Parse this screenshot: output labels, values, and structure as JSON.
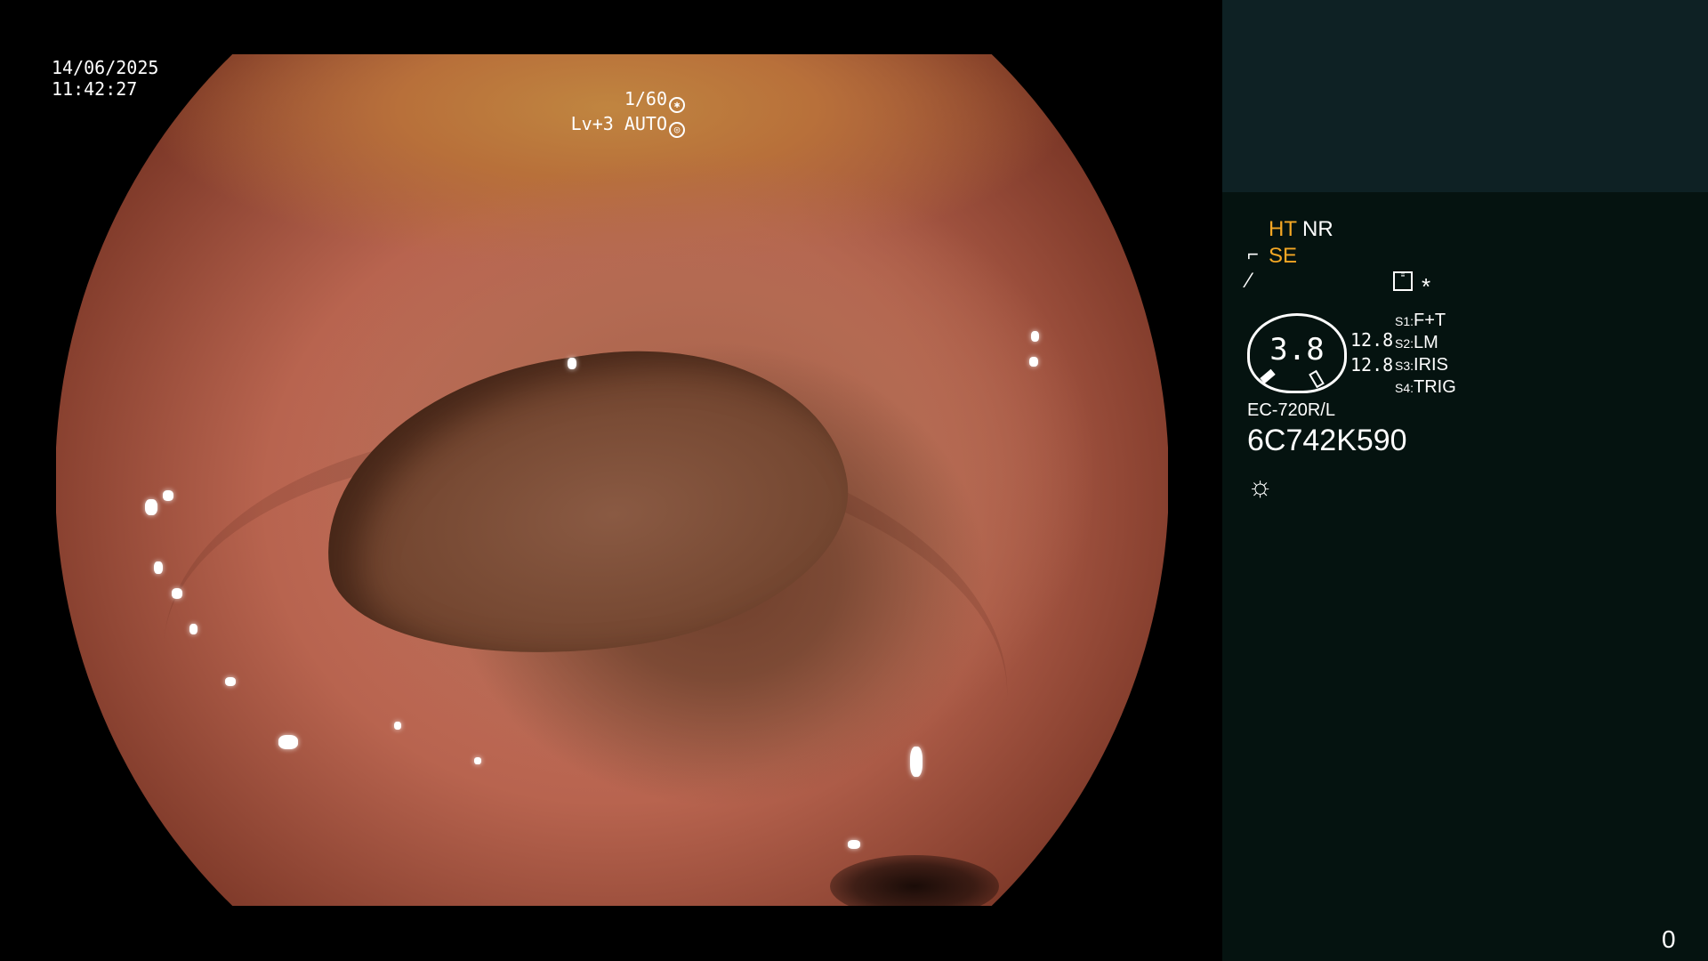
{
  "overlay": {
    "date": "14/06/2025",
    "time": "11:42:27",
    "shutter": "1/60",
    "exposure": "Lv+3 AUTO"
  },
  "panel": {
    "ht": "HT",
    "nr": "NR",
    "se": "SE",
    "star": "*",
    "gauge_value": "3.8",
    "readout_1": "12.8",
    "readout_2": "12.8",
    "switch_labels": [
      "S1:",
      "S2:",
      "S3:",
      "S4:"
    ],
    "switch_values": [
      "F+T",
      "LM",
      "IRIS",
      "TRIG"
    ],
    "scope_model": "EC-720R/L",
    "serial": "6C742K590",
    "page_number": "0"
  },
  "colors": {
    "accent_amber": "#f4a724",
    "panel_bg": "#051310",
    "panel_top_bg": "#0e2124"
  },
  "icons": [
    "shutter-icon",
    "auto-exposure-icon",
    "structure-enhance-icon",
    "tone-curve-icon",
    "memo-icon",
    "light-icon"
  ]
}
